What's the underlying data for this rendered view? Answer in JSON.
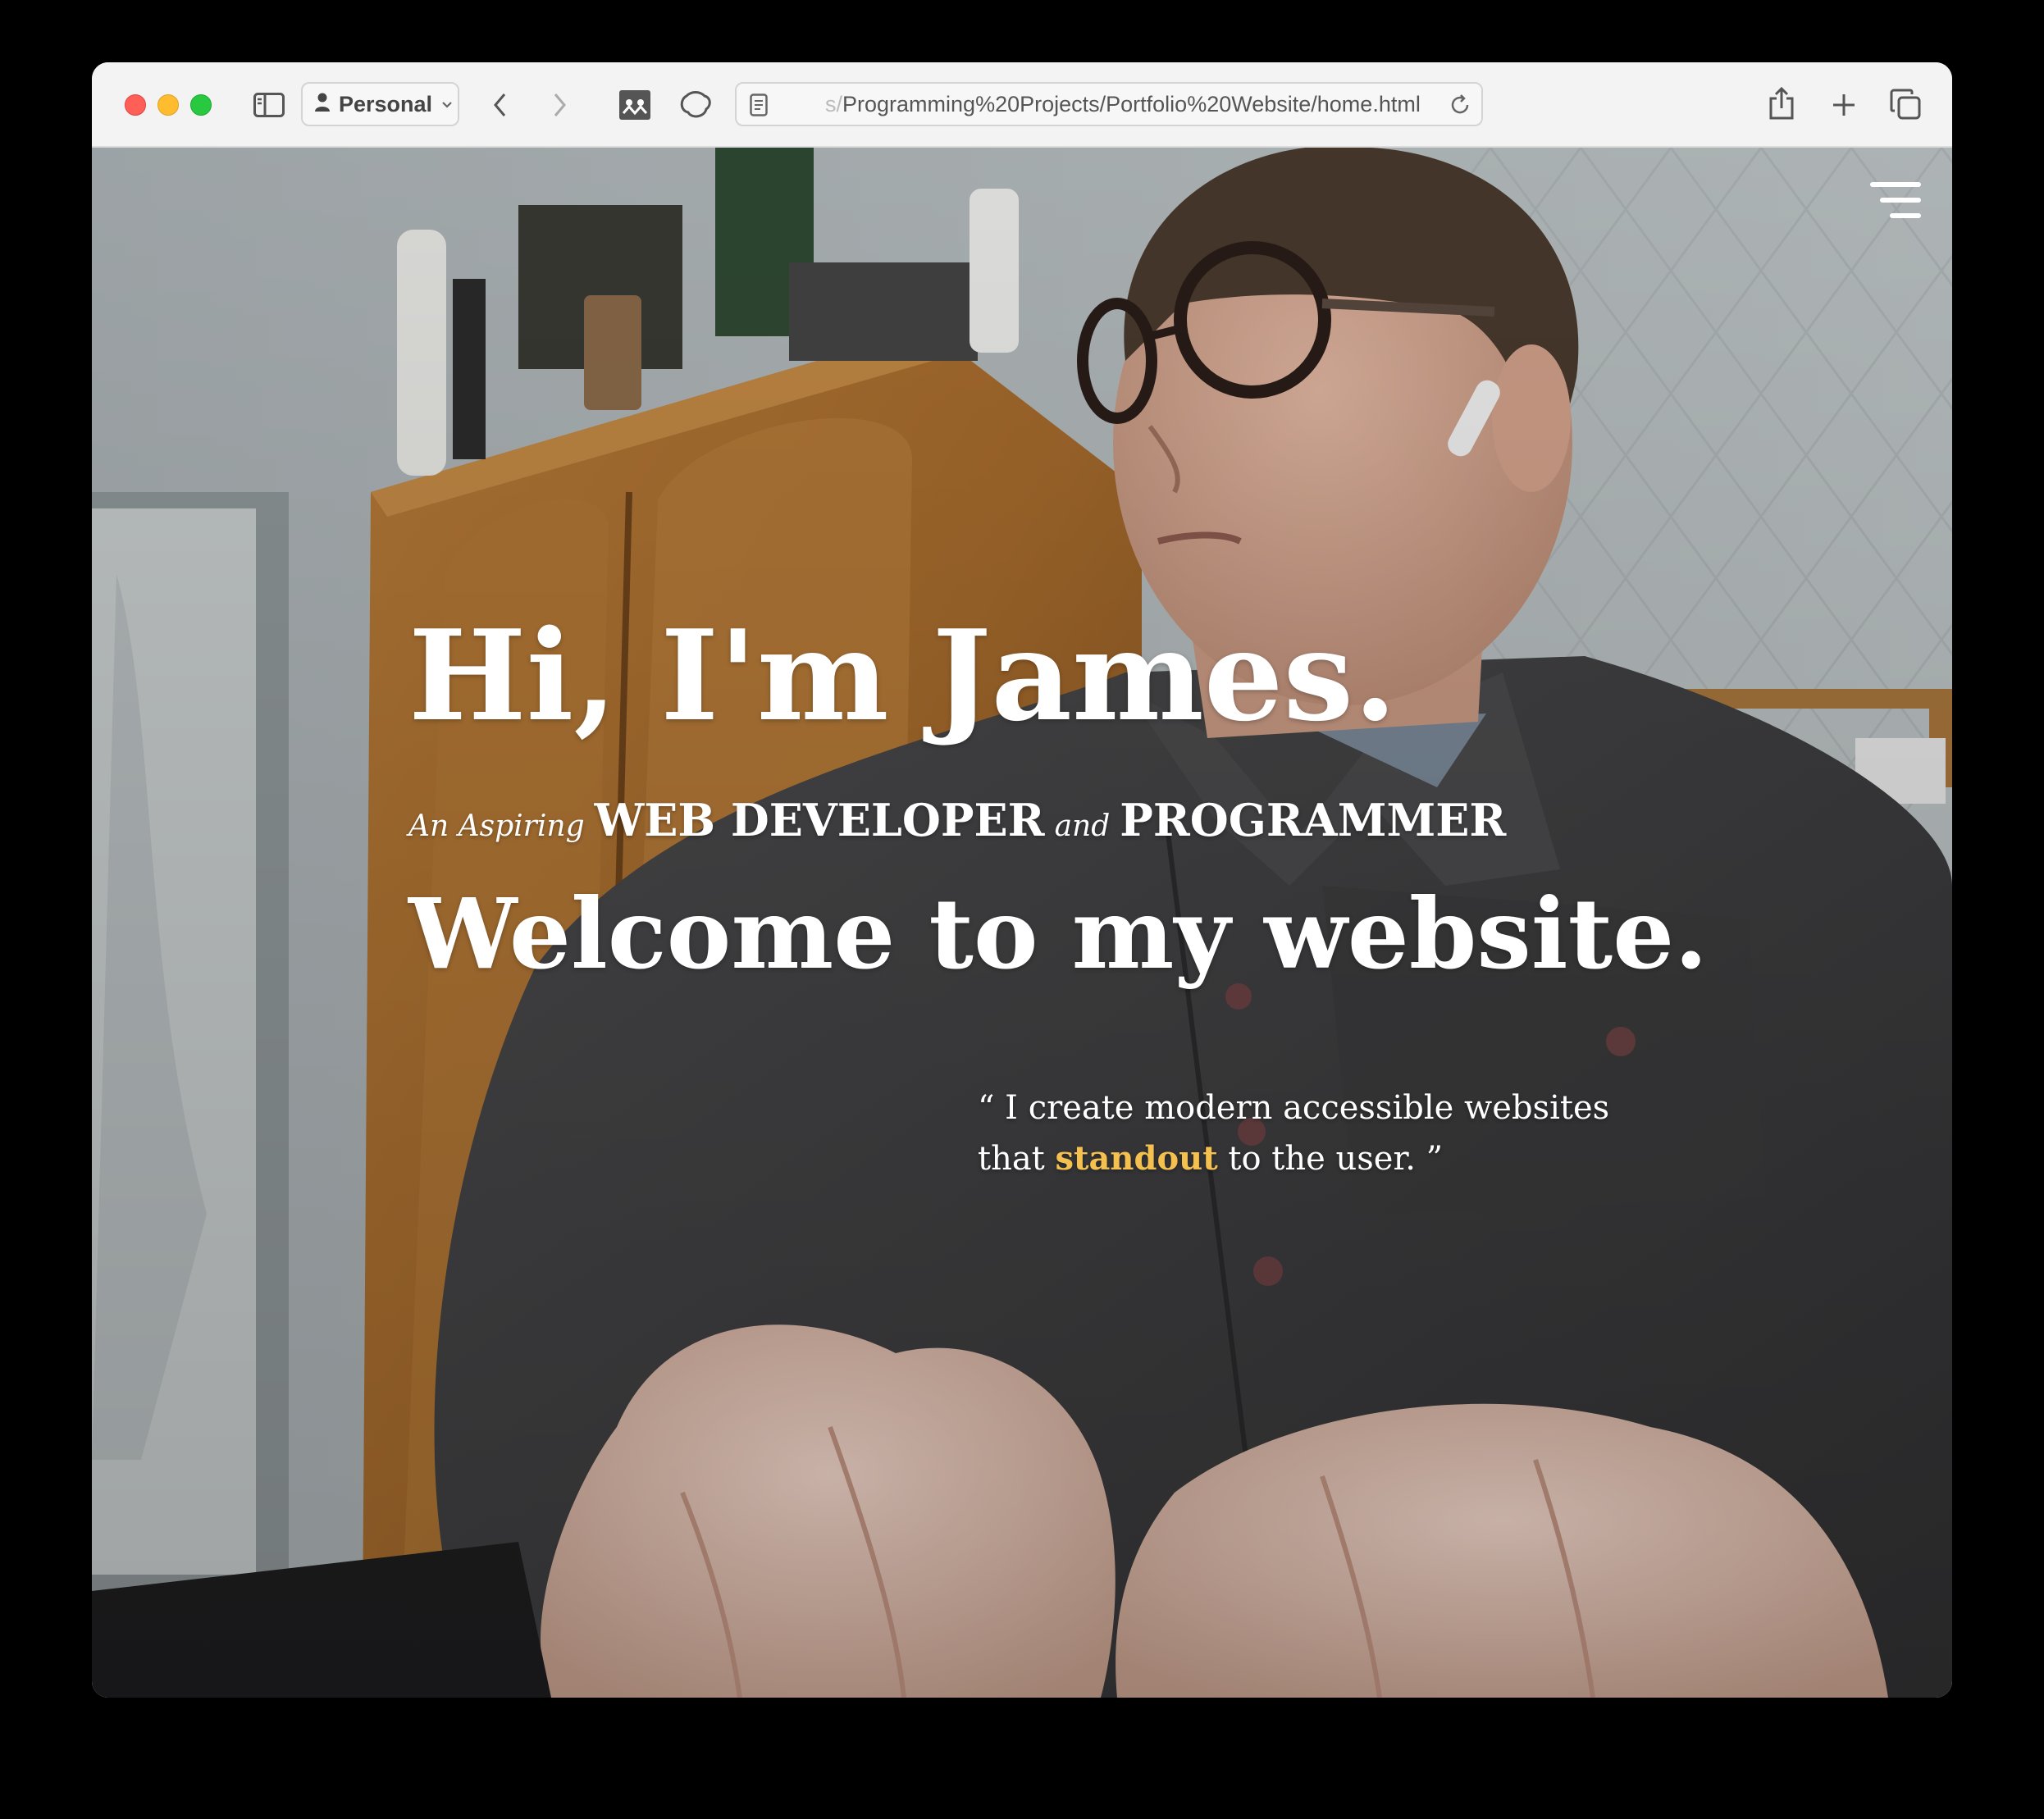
{
  "browser": {
    "profile_label": "Personal",
    "address_prefix": "s/",
    "address": "Programming%20Projects/Portfolio%20Website/home.html",
    "icons": {
      "sidebar": "sidebar-icon",
      "profile": "person-icon",
      "back": "chevron-left-icon",
      "forward": "chevron-right-icon",
      "extension": "extension-icon",
      "shield": "shield-icon",
      "page": "page-icon",
      "reload": "reload-icon",
      "share": "share-icon",
      "new_tab": "plus-icon",
      "tabs_overview": "tabs-icon"
    }
  },
  "hero": {
    "greeting": "Hi, I'm James.",
    "tagline": {
      "prefix": "An Aspiring",
      "role1": "WEB DEVELOPER",
      "conjunction": "and",
      "role2": "PROGRAMMER"
    },
    "welcome": "Welcome to my website.",
    "quote": {
      "open_mark": "“",
      "line1": "I create modern accessible websites",
      "line2_before": "that",
      "highlight": "standout",
      "line2_after": "to the user.",
      "close_mark": "”"
    }
  },
  "menu_icon": "hamburger-menu-icon",
  "colors": {
    "highlight": "#f4c04f",
    "hero_text": "#ffffff",
    "close": "#fe5f57",
    "minimize": "#febc2e",
    "maximize": "#28c840"
  }
}
